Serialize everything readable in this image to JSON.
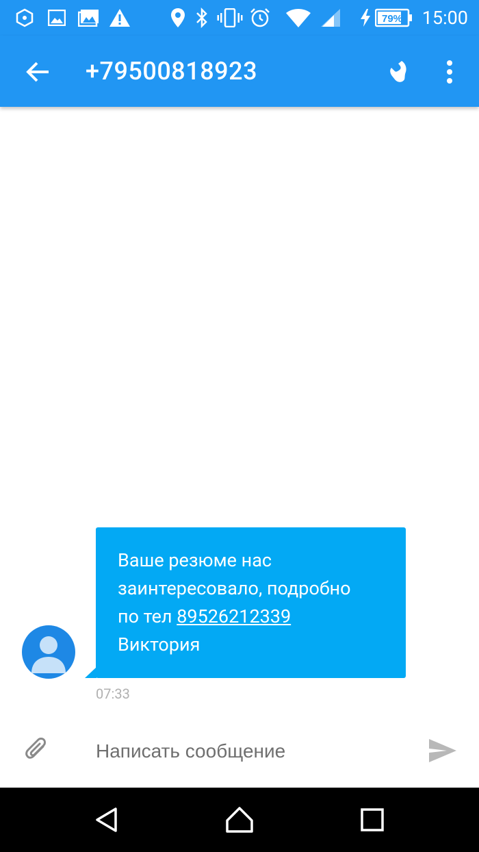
{
  "status_bar": {
    "time": "15:00",
    "battery": "79%",
    "icons": [
      "app-notification-icon",
      "image-notification-icon",
      "gallery-notification-icon",
      "warning-icon",
      "location-icon",
      "bluetooth-icon",
      "vibrate-icon",
      "alarm-icon",
      "wifi-icon",
      "cellular-signal-icon",
      "charging-icon",
      "battery-icon"
    ]
  },
  "header": {
    "title": "+79500818923",
    "icons": [
      "back-arrow-icon",
      "phone-call-icon",
      "more-vert-icon"
    ]
  },
  "message": {
    "lines": [
      "Ваше резюме нас",
      "заинтересовало, подробно",
      "по тел "
    ],
    "phone_link": "89526212339",
    "signature": "Виктория",
    "time": "07:33"
  },
  "composer": {
    "placeholder": "Написать сообщение",
    "icons": [
      "attach-icon",
      "send-icon"
    ]
  },
  "nav_bar": {
    "icons": [
      "nav-back-icon",
      "nav-home-icon",
      "nav-recents-icon"
    ]
  },
  "colors": {
    "primary": "#2196f3",
    "bubble": "#03a9f4",
    "avatar": "#1e88e5",
    "timestamp": "#b0b0b0",
    "placeholder": "#6f6f6f"
  }
}
